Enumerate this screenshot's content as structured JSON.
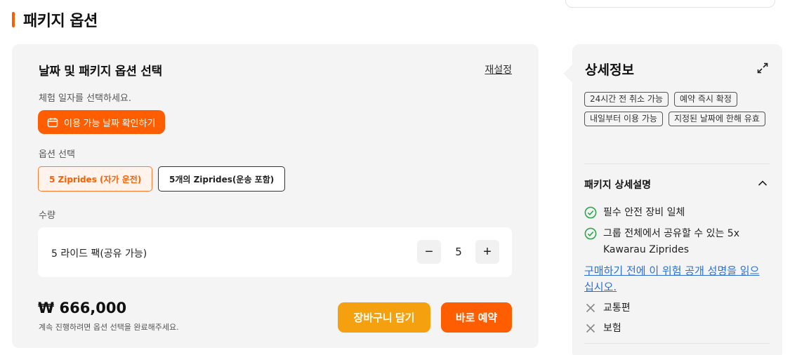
{
  "page": {
    "section_title": "패키지 옵션"
  },
  "options_card": {
    "heading": "날짜 및 패키지 옵션 선택",
    "reset_label": "재설정",
    "date_hint": "체험 일자를 선택하세요.",
    "date_button_label": "이용 가능 날짜 확인하기",
    "option_label": "옵션 선택",
    "options": [
      {
        "label": "5 Ziprides (자가 운전)",
        "selected": true
      },
      {
        "label": "5개의 Ziprides(운송 포함)",
        "selected": false
      }
    ],
    "quantity_label": "수량",
    "quantity_item": "5 라이드 팩(공유 가능)",
    "quantity_value": "5",
    "minus_label": "−",
    "plus_label": "+",
    "price": "₩ 666,000",
    "price_note": "계속 진행하려면 옵션 선택을 완료해주세요.",
    "cart_button_label": "장바구니 담기",
    "book_button_label": "바로 예약"
  },
  "detail_panel": {
    "title": "상세정보",
    "tags": [
      "24시간 전 취소 가능",
      "예약 즉시 확정",
      "내일부터 이용 가능",
      "지정된 날짜에 한해 유효"
    ],
    "package_heading": "패키지 상세설명",
    "included": [
      "필수 안전 장비 일체",
      "그룹 전체에서 공유할 수 있는 5x Kawarau Ziprides"
    ],
    "waiver_link": "구매하기 전에 이 위험 공개 성명을 읽으십시오.",
    "excluded": [
      "교통편",
      "보험"
    ]
  },
  "colors": {
    "accent": "#ff5e00",
    "cart": "#f5a10f",
    "link": "#2c6fd6",
    "check": "#2fa84f",
    "panel_bg": "#f4f4f4"
  },
  "icons": {
    "date_button": "calendar-icon",
    "expand": "expand-icon",
    "collapse": "chevron-up-icon",
    "included": "check-circle-icon",
    "excluded": "x-icon"
  }
}
